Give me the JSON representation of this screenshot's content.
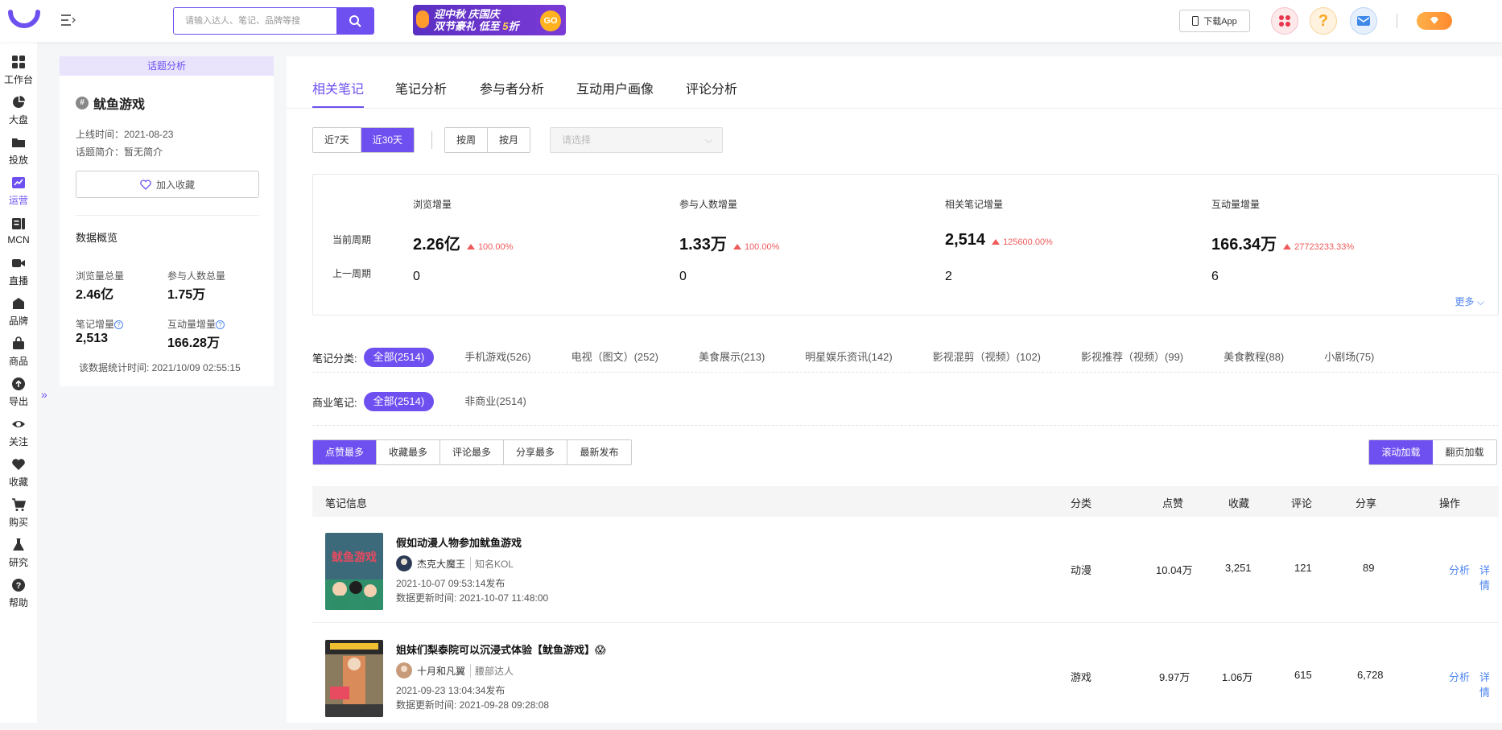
{
  "topbar": {
    "search_placeholder": "请输入达人、笔记、品牌等搜",
    "promo_line1": "迎中秋 庆国庆",
    "promo_line2a": "双节豪礼 低至",
    "promo_line2b": "5",
    "promo_line2c": "折",
    "promo_go": "GO",
    "download_app": "下载App",
    "accent_color": "#6e4ff0"
  },
  "sidenav": [
    {
      "label": "工作台",
      "icon": "grid-icon"
    },
    {
      "label": "大盘",
      "icon": "pie-icon"
    },
    {
      "label": "投放",
      "icon": "folder-icon"
    },
    {
      "label": "运营",
      "icon": "trend-icon"
    },
    {
      "label": "MCN",
      "icon": "id-card-icon"
    },
    {
      "label": "直播",
      "icon": "video-icon"
    },
    {
      "label": "品牌",
      "icon": "shop-icon"
    },
    {
      "label": "商品",
      "icon": "bag-icon"
    },
    {
      "label": "导出",
      "icon": "upload-icon"
    },
    {
      "label": "关注",
      "icon": "eye-icon"
    },
    {
      "label": "收藏",
      "icon": "heart-icon"
    },
    {
      "label": "购买",
      "icon": "cart-icon"
    },
    {
      "label": "研究",
      "icon": "flask-icon"
    },
    {
      "label": "帮助",
      "icon": "help-icon"
    }
  ],
  "topic_panel": {
    "header": "话题分析",
    "name": "鱿鱼游戏",
    "online_time": "上线时间：2021-08-23",
    "intro": "话题简介：暂无简介",
    "fav_button": "加入收藏",
    "overview_title": "数据概览",
    "stats": [
      {
        "label": "浏览量总量",
        "value": "2.46亿"
      },
      {
        "label": "参与人数总量",
        "value": "1.75万"
      },
      {
        "label": "笔记增量",
        "value": "2,513"
      },
      {
        "label": "互动量增量",
        "value": "166.28万"
      }
    ],
    "stat_time": "该数据统计时间:   2021/10/09 02:55:15"
  },
  "tabs": [
    "相关笔记",
    "笔记分析",
    "参与者分析",
    "互动用户画像",
    "评论分析"
  ],
  "range_filters": [
    "近7天",
    "近30天"
  ],
  "period_filters": [
    "按周",
    "按月"
  ],
  "select_placeholder": "请选择",
  "kpis": {
    "row_current": "当前周期",
    "row_previous": "上一周期",
    "items": [
      {
        "label": "浏览增量",
        "value": "2.26亿",
        "change": "100.00%",
        "previous": "0"
      },
      {
        "label": "参与人数增量",
        "value": "1.33万",
        "change": "100.00%",
        "previous": "0"
      },
      {
        "label": "相关笔记增量",
        "value": "2,514",
        "change": "125600.00%",
        "previous": "2"
      },
      {
        "label": "互动量增量",
        "value": "166.34万",
        "change": "27723233.33%",
        "previous": "6"
      }
    ]
  },
  "categories": {
    "label": "笔记分类:",
    "items": [
      "全部(2514)",
      "手机游戏(526)",
      "电视（图文）(252)",
      "美食展示(213)",
      "明星娱乐资讯(142)",
      "影视混剪（视频）(102)",
      "影视推荐（视频）(99)",
      "美食教程(88)",
      "小剧场(75)"
    ],
    "more": "更多"
  },
  "commercial": {
    "label": "商业笔记:",
    "items": [
      "全部(2514)",
      "非商业(2514)"
    ]
  },
  "sort_options": [
    "点赞最多",
    "收藏最多",
    "评论最多",
    "分享最多",
    "最新发布"
  ],
  "load_options": [
    "滚动加载",
    "翻页加载"
  ],
  "table": {
    "headers": [
      "笔记信息",
      "分类",
      "点赞",
      "收藏",
      "评论",
      "分享",
      "操作"
    ],
    "rows": [
      {
        "title": "假如动漫人物参加鱿鱼游戏",
        "author": "杰克大魔王",
        "author_tag": "知名KOL",
        "published": "2021-10-07 09:53:14发布",
        "updated": "数据更新时间:   2021-10-07 11:48:00",
        "category": "动漫",
        "likes": "10.04万",
        "collects": "3,251",
        "comments": "121",
        "shares": "89",
        "action_analyze": "分析",
        "action_detail": "详情"
      },
      {
        "title": "姐妹们梨泰院可以沉浸式体验【鱿鱼游戏】😱",
        "author": "十月和凡翼",
        "author_tag": "腰部达人",
        "published": "2021-09-23 13:04:34发布",
        "updated": "数据更新时间:   2021-09-28 09:28:08",
        "category": "游戏",
        "likes": "9.97万",
        "collects": "1.06万",
        "comments": "615",
        "shares": "6,728",
        "action_analyze": "分析",
        "action_detail": "详情"
      }
    ]
  }
}
